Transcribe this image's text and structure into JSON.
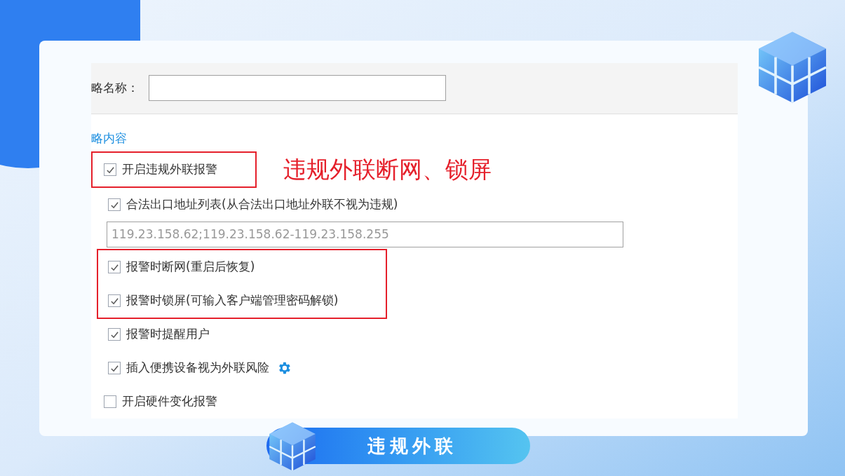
{
  "policy_name": {
    "label": "略名称："
  },
  "section_title": "略内容",
  "annotation": "违规外联断网、锁屏",
  "options": [
    {
      "label": "开启违规外联报警",
      "checked": true,
      "highlighted": true,
      "children": [
        {
          "label": "合法出口地址列表(从合法出口地址外联不视为违规)",
          "checked": true,
          "highlighted": false,
          "field": {
            "value": "119.23.158.62;119.23.158.62-119.23.158.255"
          }
        },
        {
          "label": "报警时断网(重启后恢复)",
          "checked": true,
          "highlighted": true
        },
        {
          "label": "报警时锁屏(可输入客户端管理密码解锁)",
          "checked": true,
          "highlighted": true
        },
        {
          "label": "报警时提醒用户",
          "checked": true,
          "highlighted": false
        },
        {
          "label": "插入便携设备视为外联风险",
          "checked": true,
          "highlighted": false,
          "has_settings": true
        }
      ]
    },
    {
      "label": "开启硬件变化报警",
      "checked": false,
      "highlighted": false
    }
  ],
  "banner": {
    "title": "违规外联"
  }
}
